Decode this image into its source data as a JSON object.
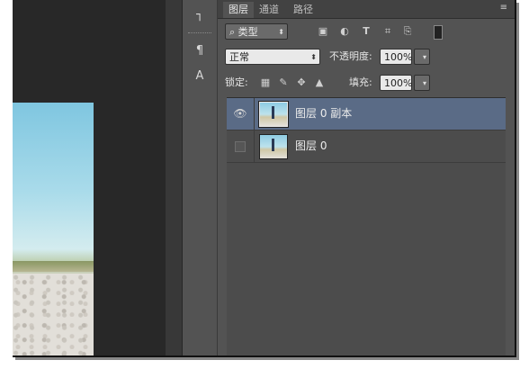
{
  "tabs": [
    "图层",
    "通道",
    "路径"
  ],
  "filter": {
    "label": "类型"
  },
  "blend": {
    "mode": "正常",
    "opacity_label": "不透明度:",
    "opacity_value": "100%"
  },
  "lock": {
    "label": "锁定:",
    "fill_label": "填充:",
    "fill_value": "100%"
  },
  "layers": [
    {
      "name": "图层 0 副本",
      "visible": true,
      "selected": true
    },
    {
      "name": "图层 0",
      "visible": false,
      "selected": false
    }
  ],
  "icons": {
    "filter": "search-icon",
    "filter_types": [
      "image-filter-icon",
      "adjustment-filter-icon",
      "type-filter-icon",
      "shape-filter-icon",
      "smart-object-filter-icon",
      "filter-toggle-icon"
    ],
    "lock": [
      "lock-transparent-icon",
      "lock-image-icon",
      "lock-position-icon",
      "lock-all-icon"
    ],
    "tools": [
      "paragraph-panel-icon",
      "character-panel-icon"
    ]
  },
  "colors": {
    "selection": "#5a6b86",
    "panel": "#535353",
    "canvas": "#282828"
  }
}
